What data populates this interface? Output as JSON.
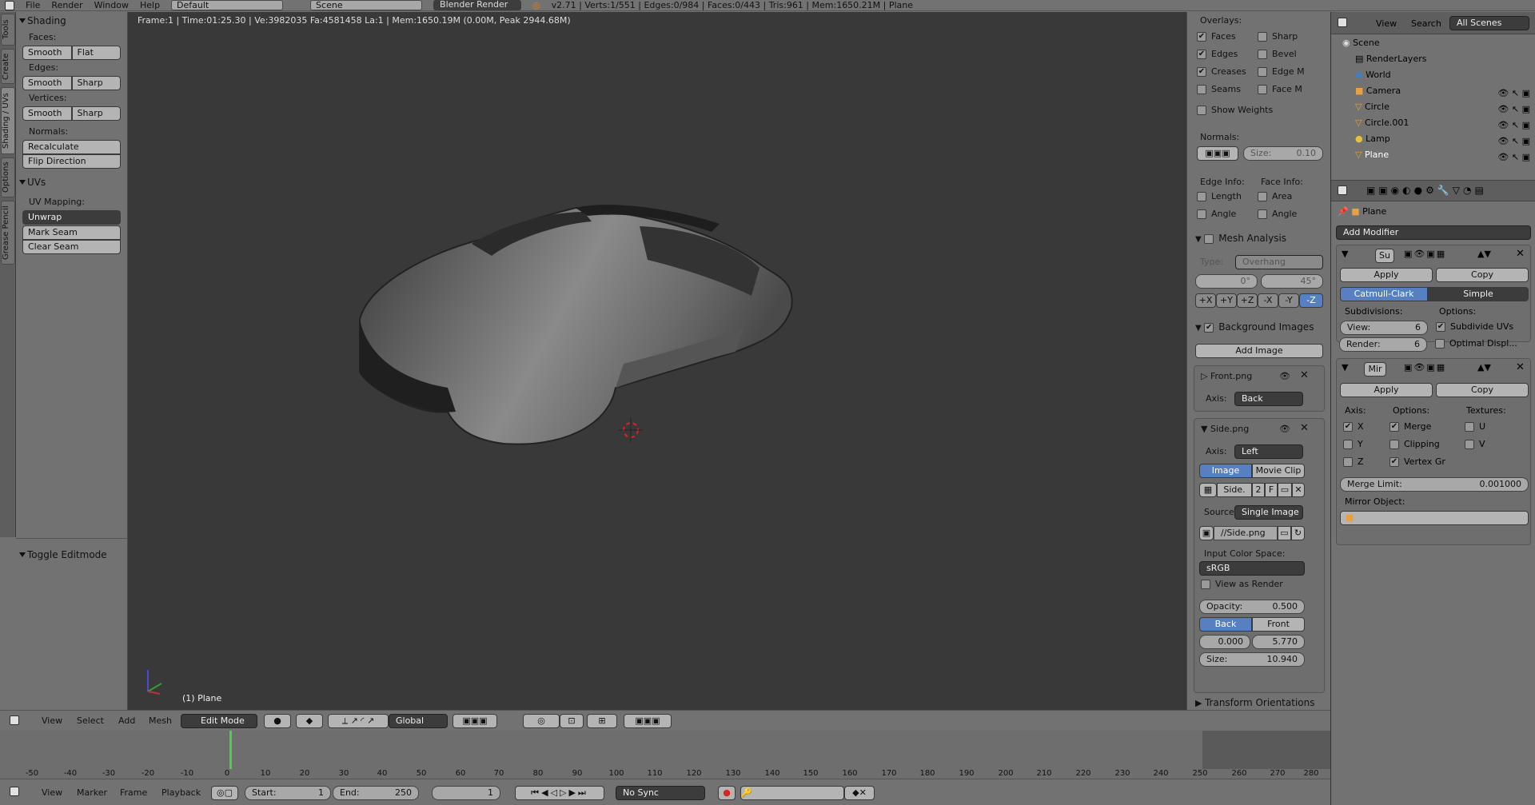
{
  "topbar": {
    "menus": [
      "File",
      "Render",
      "Window",
      "Help"
    ],
    "layout": "Default",
    "scene": "Scene",
    "engine": "Blender Render",
    "stats": "v2.71 | Verts:1/551 | Edges:0/984 | Faces:0/443 | Tris:961 | Mem:1650.21M | Plane"
  },
  "vtabs": [
    "Tools",
    "Create",
    "Shading / UVs",
    "Options",
    "Grease Pencil"
  ],
  "tools": {
    "shading_title": "Shading",
    "faces_label": "Faces:",
    "faces_btns": [
      "Smooth",
      "Flat"
    ],
    "edges_label": "Edges:",
    "edges_btns": [
      "Smooth",
      "Sharp"
    ],
    "vertices_label": "Vertices:",
    "vertices_btns": [
      "Smooth",
      "Sharp"
    ],
    "normals_label": "Normals:",
    "normals_btns": [
      "Recalculate",
      "Flip Direction"
    ],
    "uvs_title": "UVs",
    "uvmapping_label": "UV Mapping:",
    "unwrap": "Unwrap",
    "uv_btns": [
      "Mark Seam",
      "Clear Seam"
    ],
    "toggle_editmode": "Toggle Editmode"
  },
  "viewport": {
    "info": "Frame:1 | Time:01:25.30 | Ve:3982035 Fa:4581458 La:1 | Mem:1650.19M (0.00M, Peak 2944.68M)",
    "object": "(1) Plane"
  },
  "npanel": {
    "overlays": "Overlays:",
    "ov_left": [
      {
        "l": "Faces",
        "on": true
      },
      {
        "l": "Edges",
        "on": true
      },
      {
        "l": "Creases",
        "on": true
      },
      {
        "l": "Seams",
        "on": false
      }
    ],
    "ov_right": [
      {
        "l": "Sharp",
        "on": false
      },
      {
        "l": "Bevel",
        "on": false
      },
      {
        "l": "Edge M",
        "on": false
      },
      {
        "l": "Face M",
        "on": false
      }
    ],
    "show_weights": "Show Weights",
    "normals": "Normals:",
    "size": "Size:",
    "size_val": "0.10",
    "edge_info": "Edge Info:",
    "face_info": "Face Info:",
    "edge_items": [
      "Length",
      "Angle"
    ],
    "face_items": [
      "Area",
      "Angle"
    ],
    "mesh_analysis": "Mesh Analysis",
    "type_label": "Type:",
    "type_val": "Overhang",
    "deg1": "0°",
    "deg2": "45°",
    "axes": [
      "+X",
      "+Y",
      "+Z",
      "-X",
      "-Y",
      "-Z"
    ],
    "bg_images": "Background Images",
    "add_image": "Add Image",
    "front_png": "Front.png",
    "axis_label": "Axis:",
    "front_axis": "Back",
    "side_png": "Side.png",
    "side_axis": "Left",
    "image_tab": "Image",
    "movieclip_tab": "Movie Clip",
    "side_field": "Side.",
    "side_num": "2",
    "side_f": "F",
    "source_label": "Source",
    "source_val": "Single Image",
    "filepath": "//Side.png",
    "input_cs": "Input Color Space:",
    "cs_val": "sRGB",
    "view_render": "View as Render",
    "opacity_label": "Opacity:",
    "opacity_val": "0.500",
    "back": "Back",
    "front": "Front",
    "x_val": "0.000",
    "y_val": "5.770",
    "size2_label": "Size:",
    "size2_val": "10.940",
    "transform_orient": "Transform Orientations"
  },
  "outliner": {
    "view": "View",
    "search": "Search",
    "all_scenes": "All Scenes",
    "items": [
      "Scene",
      "RenderLayers",
      "World",
      "Camera",
      "Circle",
      "Circle.001",
      "Lamp",
      "Plane"
    ]
  },
  "props": {
    "object": "Plane",
    "add_modifier": "Add Modifier",
    "mod1": "Su",
    "apply": "Apply",
    "copy": "Copy",
    "catmull": "Catmull-Clark",
    "simple": "Simple",
    "subdiv": "Subdivisions:",
    "options": "Options:",
    "view_label": "View:",
    "view_val": "6",
    "render_label": "Render:",
    "render_val": "6",
    "subdivide_uvs": "Subdivide UVs",
    "optimal": "Optimal Displ...",
    "mod2": "Mir",
    "axis": "Axis:",
    "opts": "Options:",
    "textures": "Textures:",
    "x": "X",
    "y": "Y",
    "z": "Z",
    "merge": "Merge",
    "clipping": "Clipping",
    "vertex_gr": "Vertex Gr",
    "u": "U",
    "v": "V",
    "merge_limit": "Merge Limit:",
    "merge_limit_val": "0.001000",
    "mirror_object": "Mirror Object:"
  },
  "vhdr": {
    "menus": [
      "View",
      "Select",
      "Add",
      "Mesh"
    ],
    "mode": "Edit Mode",
    "orient": "Global"
  },
  "timeline": {
    "ticks": [
      "-50",
      "-40",
      "-30",
      "-20",
      "-10",
      "0",
      "10",
      "20",
      "30",
      "40",
      "50",
      "60",
      "70",
      "80",
      "90",
      "100",
      "110",
      "120",
      "130",
      "140",
      "150",
      "160",
      "170",
      "180",
      "190",
      "200",
      "210",
      "220",
      "230",
      "240",
      "250",
      "260",
      "270",
      "280"
    ]
  },
  "tlhdr": {
    "menus": [
      "View",
      "Marker",
      "Frame",
      "Playback"
    ],
    "start_label": "Start:",
    "start_val": "1",
    "end_label": "End:",
    "end_val": "250",
    "cur_val": "1",
    "sync": "No Sync"
  }
}
